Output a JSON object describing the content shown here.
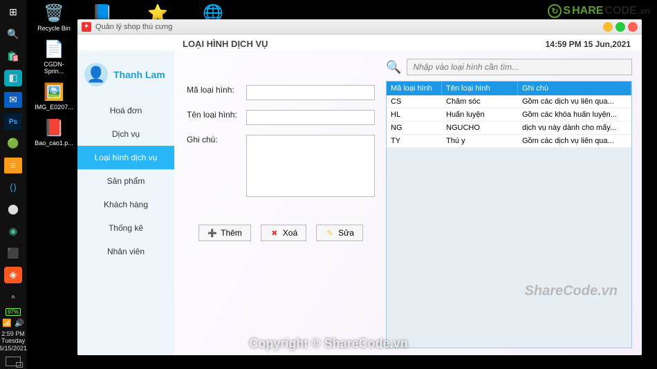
{
  "desktop_icons": [
    {
      "glyph": "🗑️",
      "label": "Recycle Bin"
    },
    {
      "glyph": "📄",
      "label": "CGDN-Sprin..."
    },
    {
      "glyph": "🖼️",
      "label": "IMG_E0207..."
    },
    {
      "glyph": "📕",
      "label": "Bao_cao1.p..."
    }
  ],
  "desktop_row_top": [
    {
      "glyph": "📘",
      "label": ""
    },
    {
      "glyph": "⭐",
      "label": ""
    },
    {
      "glyph": "🌐",
      "label": ""
    }
  ],
  "taskbar_clock": {
    "time": "2:59 PM",
    "day": "Tuesday",
    "date": "6/15/2021"
  },
  "taskbar_battery": "97%",
  "window": {
    "title": "Quản lý shop thú cưng",
    "header_title": "LOẠI HÌNH DỊCH VỤ",
    "header_time": "14:59 PM  15 Jun,2021",
    "user_name": "Thanh Lam",
    "nav": [
      "Hoá đơn",
      "Dịch vụ",
      "Loại hình dịch vụ",
      "Sản phẩm",
      "Khách hàng",
      "Thống kê",
      "Nhân viên"
    ],
    "nav_active_index": 2,
    "form": {
      "label_code": "Mã loại hình:",
      "label_name": "Tên loại hình:",
      "label_note": "Ghi chú:",
      "value_code": "",
      "value_name": "",
      "value_note": ""
    },
    "buttons": {
      "add": "Thêm",
      "del": "Xoá",
      "edit": "Sửa"
    },
    "search_placeholder": "Nhập vào loại hình cần tìm...",
    "columns": [
      "Mã loại hình",
      "Tên loại hình",
      "Ghi chú"
    ],
    "rows": [
      {
        "code": "CS",
        "name": "Chăm sóc",
        "note": "Gồm các dịch vụ liên qua..."
      },
      {
        "code": "HL",
        "name": "Huấn luyện",
        "note": "Gồm các khóa huấn luyện..."
      },
      {
        "code": "NG",
        "name": "NGUCHO",
        "note": "dịch vụ này dành cho mấy..."
      },
      {
        "code": "TY",
        "name": "Thú y",
        "note": "Gồm các dịch vụ liên qua..."
      }
    ]
  },
  "watermarks": {
    "logo_prefix": "S",
    "logo_text_green": "HARE",
    "logo_text_black": "CODE",
    "logo_suffix": ".vn",
    "table_mark": "ShareCode.vn",
    "copyright": "Copyright © ShareCode.vn"
  }
}
